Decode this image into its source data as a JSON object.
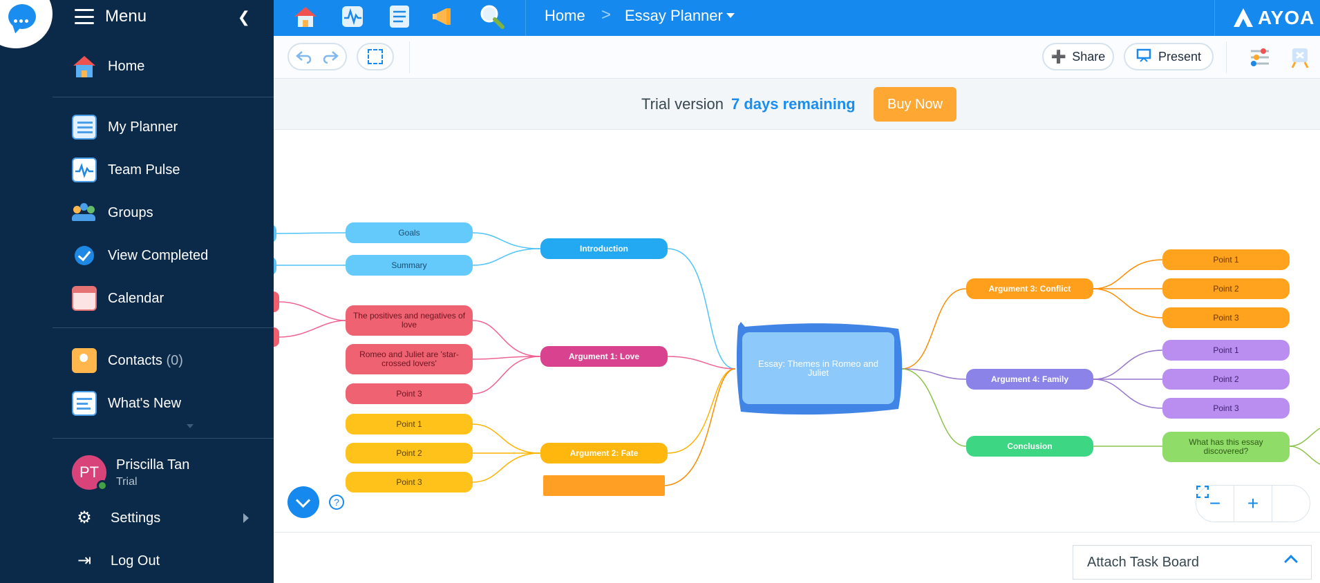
{
  "sidebar": {
    "title": "Menu",
    "items": [
      {
        "label": "Home",
        "icon": "home-icon"
      },
      {
        "label": "My Planner",
        "icon": "planner-icon"
      },
      {
        "label": "Team Pulse",
        "icon": "pulse-icon"
      },
      {
        "label": "Groups",
        "icon": "groups-icon"
      },
      {
        "label": "View Completed",
        "icon": "check-circle-icon"
      },
      {
        "label": "Calendar",
        "icon": "calendar-icon"
      },
      {
        "label": "Contacts",
        "count": "(0)",
        "icon": "contacts-icon"
      },
      {
        "label": "What's New",
        "icon": "news-icon"
      }
    ],
    "user": {
      "initials": "PT",
      "name": "Priscilla Tan",
      "plan": "Trial"
    },
    "settings_label": "Settings",
    "logout_label": "Log Out"
  },
  "topbar": {
    "breadcrumb_home": "Home",
    "breadcrumb_separator": ">",
    "breadcrumb_current": "Essay Planner",
    "logo_text": "AYOA",
    "accent": "#1589ee"
  },
  "toolbar": {
    "share_label": "Share",
    "present_label": "Present"
  },
  "trial": {
    "text": "Trial version",
    "days": "7 days remaining",
    "buy_label": "Buy Now"
  },
  "mindmap": {
    "central": "Essay: Themes in Romeo and Juliet",
    "branches": {
      "introduction": {
        "label": "Introduction",
        "children": [
          "Goals",
          "Summary"
        ]
      },
      "argument1": {
        "label": "Argument 1: Love",
        "children": [
          "The positives and negatives of love",
          "Romeo and Juliet are 'star-crossed lovers'",
          "Point 3"
        ]
      },
      "argument2": {
        "label": "Argument 2: Fate",
        "children": [
          "Point 1",
          "Point 2",
          "Point 3"
        ]
      },
      "argument3": {
        "label": "Argument 3: Conflict",
        "children": [
          "Point 1",
          "Point 2",
          "Point 3"
        ]
      },
      "argument4": {
        "label": "Argument 4: Family",
        "children": [
          "Point 1",
          "Point 2",
          "Point 3"
        ]
      },
      "conclusion": {
        "label": "Conclusion",
        "children": [
          "What has this essay discovered?"
        ]
      }
    },
    "help_label": "?"
  },
  "zoom": {
    "out": "−",
    "in": "+"
  },
  "bottom": {
    "attach_label": "Attach Task Board"
  }
}
